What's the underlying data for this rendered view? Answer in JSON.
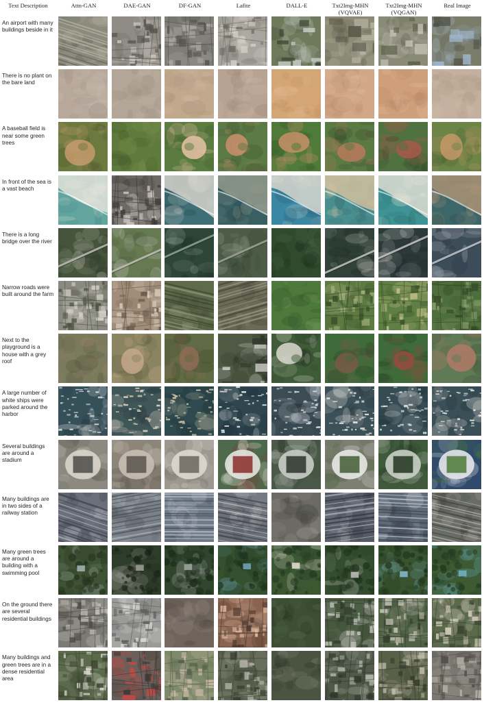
{
  "columns": [
    "Text Description",
    "Attn-GAN",
    "DAE-GAN",
    "DF-GAN",
    "Lafite",
    "DALL-E",
    "Txt2Img-MHN\n(VQVAE)",
    "Txt2Img-MHN\n(VQGAN)",
    "Real Image"
  ],
  "rows": [
    {
      "text": "An airport with many buildings beside in it",
      "tiles": [
        {
          "base": "#8c8b7e",
          "accent": "#b7b5a3",
          "dark": "#5f5e55",
          "pattern": "lines"
        },
        {
          "base": "#8f8c86",
          "accent": "#c9c4bd",
          "dark": "#5a5752",
          "pattern": "grid"
        },
        {
          "base": "#7f7d78",
          "accent": "#a9a6a0",
          "dark": "#55534f",
          "pattern": "grid"
        },
        {
          "base": "#a7a59d",
          "accent": "#d2d0c8",
          "dark": "#6c6a63",
          "pattern": "grid"
        },
        {
          "base": "#6f7a5c",
          "accent": "#c3c8c1",
          "dark": "#3d4634",
          "pattern": "blocks"
        },
        {
          "base": "#8b8a74",
          "accent": "#b9b7a5",
          "dark": "#57584a",
          "pattern": "blocks"
        },
        {
          "base": "#8a8a78",
          "accent": "#cfcfc2",
          "dark": "#5c5f4a",
          "pattern": "blocks"
        },
        {
          "base": "#7b7d6b",
          "accent": "#9fb6cc",
          "dark": "#4f5245",
          "pattern": "blocks"
        }
      ]
    },
    {
      "text": "There is no plant on the bare land",
      "tiles": [
        {
          "base": "#b7a89b",
          "accent": "#cdbfb3",
          "dark": "#9c8c80",
          "pattern": "soft"
        },
        {
          "base": "#b3a597",
          "accent": "#c8bbae",
          "dark": "#988a7d",
          "pattern": "soft"
        },
        {
          "base": "#c2a98e",
          "accent": "#d4bfa7",
          "dark": "#a78f75",
          "pattern": "soft"
        },
        {
          "base": "#b7a392",
          "accent": "#cdbbab",
          "dark": "#9a8776",
          "pattern": "soft"
        },
        {
          "base": "#d4a675",
          "accent": "#e4c199",
          "dark": "#b8885a",
          "pattern": "soft"
        },
        {
          "base": "#d1a787",
          "accent": "#e3c2a6",
          "dark": "#b48969",
          "pattern": "soft"
        },
        {
          "base": "#cf9f7c",
          "accent": "#e2bc9c",
          "dark": "#b3815f",
          "pattern": "soft"
        },
        {
          "base": "#c4b09e",
          "accent": "#d4c3b3",
          "dark": "#aa9683",
          "pattern": "soft"
        }
      ]
    },
    {
      "text": "A baseball field is near some green trees",
      "tiles": [
        {
          "base": "#6d7a3f",
          "accent": "#c59b6c",
          "dark": "#46502a",
          "pattern": "field"
        },
        {
          "base": "#5e7a3c",
          "accent": "#7b9350",
          "dark": "#3e5428",
          "pattern": "soft"
        },
        {
          "base": "#5b7c40",
          "accent": "#e9c3a7",
          "dark": "#3c5429",
          "pattern": "field"
        },
        {
          "base": "#5c7a45",
          "accent": "#c98f6d",
          "dark": "#39512c",
          "pattern": "field"
        },
        {
          "base": "#4f7a3a",
          "accent": "#c8916a",
          "dark": "#324f24",
          "pattern": "field"
        },
        {
          "base": "#5a7a44",
          "accent": "#b67a5c",
          "dark": "#2f4425",
          "pattern": "field"
        },
        {
          "base": "#507240",
          "accent": "#a8584a",
          "dark": "#2c4226",
          "pattern": "field"
        },
        {
          "base": "#6c8446",
          "accent": "#c59868",
          "dark": "#475c2e",
          "pattern": "field"
        }
      ]
    },
    {
      "text": "In front of the sea is a vast beach",
      "tiles": [
        {
          "base": "#62a59f",
          "accent": "#e9e6dd",
          "dark": "#3e7e7a",
          "pattern": "coast"
        },
        {
          "base": "#6d6965",
          "accent": "#c9c4bf",
          "dark": "#3b3835",
          "pattern": "grid"
        },
        {
          "base": "#3e6e76",
          "accent": "#dfd9cf",
          "dark": "#284b52",
          "pattern": "coast"
        },
        {
          "base": "#385f62",
          "accent": "#9a9d8f",
          "dark": "#223f43",
          "pattern": "coast"
        },
        {
          "base": "#3a87a3",
          "accent": "#e3ddd2",
          "dark": "#24566b",
          "pattern": "coast"
        },
        {
          "base": "#4a8f90",
          "accent": "#d9c3a0",
          "dark": "#2f6062",
          "pattern": "coast"
        },
        {
          "base": "#3f9394",
          "accent": "#e8e2d6",
          "dark": "#2a6566",
          "pattern": "coast"
        },
        {
          "base": "#3d6669",
          "accent": "#b09577",
          "dark": "#26474a",
          "pattern": "coast"
        }
      ]
    },
    {
      "text": "There is a long bridge over the river",
      "tiles": [
        {
          "base": "#45543b",
          "accent": "#b7b7ad",
          "dark": "#2c3727",
          "pattern": "bridge"
        },
        {
          "base": "#667a52",
          "accent": "#bbbcb0",
          "dark": "#435238",
          "pattern": "bridge"
        },
        {
          "base": "#2e4636",
          "accent": "#8c9c92",
          "dark": "#1b2c22",
          "pattern": "bridge"
        },
        {
          "base": "#4d5c46",
          "accent": "#98a090",
          "dark": "#2f3a2c",
          "pattern": "bridge"
        },
        {
          "base": "#2f4a2d",
          "accent": "#55704e",
          "dark": "#1c2d1b",
          "pattern": "soft"
        },
        {
          "base": "#30423a",
          "accent": "#bcbcb5",
          "dark": "#1d2a24",
          "pattern": "bridge"
        },
        {
          "base": "#2b3a38",
          "accent": "#c0c0bb",
          "dark": "#18232a",
          "pattern": "bridge"
        },
        {
          "base": "#3d4c59",
          "accent": "#b8bec5",
          "dark": "#27323d",
          "pattern": "bridge"
        }
      ]
    },
    {
      "text": "Narrow roads were built around the farm",
      "tiles": [
        {
          "base": "#8a8a82",
          "accent": "#d8d4cc",
          "dark": "#4d5240",
          "pattern": "grid"
        },
        {
          "base": "#a18d7a",
          "accent": "#d9cbbd",
          "dark": "#6a5a49",
          "pattern": "grid"
        },
        {
          "base": "#5f6a4a",
          "accent": "#93987c",
          "dark": "#3b4330",
          "pattern": "lines"
        },
        {
          "base": "#6b6a57",
          "accent": "#9d9a86",
          "dark": "#454536",
          "pattern": "lines"
        },
        {
          "base": "#4d7a3c",
          "accent": "#86a86a",
          "dark": "#2f4f25",
          "pattern": "soft"
        },
        {
          "base": "#5d7a42",
          "accent": "#a2b07c",
          "dark": "#384e28",
          "pattern": "grid"
        },
        {
          "base": "#5f7f44",
          "accent": "#c3c08a",
          "dark": "#3b532a",
          "pattern": "grid"
        },
        {
          "base": "#4f6e3d",
          "accent": "#89a06a",
          "dark": "#324826",
          "pattern": "grid"
        }
      ]
    },
    {
      "text": "Next to the playground is a house with a grey roof",
      "tiles": [
        {
          "base": "#7a7a5c",
          "accent": "#9b8470",
          "dark": "#4f4e3a",
          "pattern": "soft"
        },
        {
          "base": "#8a8560",
          "accent": "#c4a88c",
          "dark": "#5a5740",
          "pattern": "field"
        },
        {
          "base": "#606a44",
          "accent": "#8f6b55",
          "dark": "#3d4429",
          "pattern": "field"
        },
        {
          "base": "#4f5a45",
          "accent": "#d7d6d2",
          "dark": "#2f3629",
          "pattern": "blocks"
        },
        {
          "base": "#3f5c38",
          "accent": "#dad8d0",
          "dark": "#263923",
          "pattern": "field"
        },
        {
          "base": "#3f6a3a",
          "accent": "#7a5a48",
          "dark": "#284226",
          "pattern": "field"
        },
        {
          "base": "#3f6a3a",
          "accent": "#9a4a3e",
          "dark": "#284226",
          "pattern": "field"
        },
        {
          "base": "#5f7a55",
          "accent": "#b07a68",
          "dark": "#3b4c36",
          "pattern": "field"
        }
      ]
    },
    {
      "text": "A large number of white ships were parked around the harbor",
      "tiles": [
        {
          "base": "#355059",
          "accent": "#d9dbd9",
          "dark": "#1f3238",
          "pattern": "harbor"
        },
        {
          "base": "#40575a",
          "accent": "#d3cbb9",
          "dark": "#263638",
          "pattern": "harbor"
        },
        {
          "base": "#2f4a4f",
          "accent": "#c9c1a4",
          "dark": "#1b2e32",
          "pattern": "harbor"
        },
        {
          "base": "#2f4650",
          "accent": "#e2e1dc",
          "dark": "#1a2d35",
          "pattern": "harbor"
        },
        {
          "base": "#3b4c55",
          "accent": "#d2d6d8",
          "dark": "#222f36",
          "pattern": "harbor"
        },
        {
          "base": "#3c5058",
          "accent": "#dcdcd6",
          "dark": "#223239",
          "pattern": "harbor"
        },
        {
          "base": "#364c55",
          "accent": "#e0dfd9",
          "dark": "#1f2f36",
          "pattern": "harbor"
        },
        {
          "base": "#3a4f57",
          "accent": "#e4e3de",
          "dark": "#202f36",
          "pattern": "harbor"
        }
      ]
    },
    {
      "text": "Several buildings are around a stadium",
      "tiles": [
        {
          "base": "#8c8a80",
          "accent": "#d8d4cc",
          "dark": "#4e4c46",
          "pattern": "stadium"
        },
        {
          "base": "#8d857a",
          "accent": "#c6bfb2",
          "dark": "#5a554d",
          "pattern": "stadium"
        },
        {
          "base": "#9c9890",
          "accent": "#ddd8cf",
          "dark": "#6a665f",
          "pattern": "stadium"
        },
        {
          "base": "#4e6a4c",
          "accent": "#e6e4df",
          "dark": "#8a2e2a",
          "pattern": "stadium"
        },
        {
          "base": "#4b5a48",
          "accent": "#c9ccc8",
          "dark": "#2b3529",
          "pattern": "stadium"
        },
        {
          "base": "#7d7f72",
          "accent": "#e8e8e4",
          "dark": "#425c35",
          "pattern": "stadium"
        },
        {
          "base": "#3e5a3b",
          "accent": "#c9cfc6",
          "dark": "#223520",
          "pattern": "stadium"
        },
        {
          "base": "#2f4a6a",
          "accent": "#e4e6ea",
          "dark": "#4f7a3a",
          "pattern": "stadium"
        }
      ]
    },
    {
      "text": "Many buildings are in two sides of a railway station",
      "tiles": [
        {
          "base": "#6a6f7a",
          "accent": "#b8bbc4",
          "dark": "#3c404a",
          "pattern": "lines"
        },
        {
          "base": "#7a8088",
          "accent": "#b3b9bf",
          "dark": "#4b5057",
          "pattern": "lines"
        },
        {
          "base": "#6f7a88",
          "accent": "#b9c0c9",
          "dark": "#434b57",
          "pattern": "lines"
        },
        {
          "base": "#6c7078",
          "accent": "#c4c6ca",
          "dark": "#3e4148",
          "pattern": "lines"
        },
        {
          "base": "#6b6a64",
          "accent": "#a6a49c",
          "dark": "#403f3a",
          "pattern": "soft"
        },
        {
          "base": "#555b66",
          "accent": "#b2b6be",
          "dark": "#2e323a",
          "pattern": "lines"
        },
        {
          "base": "#5f6a78",
          "accent": "#c6ccd4",
          "dark": "#353d48",
          "pattern": "lines"
        },
        {
          "base": "#6a6c68",
          "accent": "#b9b7ae",
          "dark": "#3f413d",
          "pattern": "lines"
        }
      ]
    },
    {
      "text": "Many green trees are around a building with a swimming pool",
      "tiles": [
        {
          "base": "#3e5234",
          "accent": "#9fb2ad",
          "dark": "#263420",
          "pattern": "trees"
        },
        {
          "base": "#2e3d2a",
          "accent": "#9b9b93",
          "dark": "#1a2418",
          "pattern": "trees"
        },
        {
          "base": "#2f452c",
          "accent": "#9ba39a",
          "dark": "#1b2b1a",
          "pattern": "trees"
        },
        {
          "base": "#34502f",
          "accent": "#6fa2b5",
          "dark": "#1f331d",
          "pattern": "trees"
        },
        {
          "base": "#3b5833",
          "accent": "#e0d9cc",
          "dark": "#243921",
          "pattern": "trees"
        },
        {
          "base": "#344d2f",
          "accent": "#b7b9b2",
          "dark": "#1f321c",
          "pattern": "trees"
        },
        {
          "base": "#38532f",
          "accent": "#7fb6c8",
          "dark": "#22361d",
          "pattern": "trees"
        },
        {
          "base": "#3d5a33",
          "accent": "#6fb3c9",
          "dark": "#253b20",
          "pattern": "trees"
        }
      ]
    },
    {
      "text": "On the ground there are several residential buildings",
      "tiles": [
        {
          "base": "#7c7a74",
          "accent": "#c1bfb9",
          "dark": "#4c4a45",
          "pattern": "grid"
        },
        {
          "base": "#9a9a98",
          "accent": "#dcdcdb",
          "dark": "#5f5f5c",
          "pattern": "grid"
        },
        {
          "base": "#6e645c",
          "accent": "#958a80",
          "dark": "#4a413a",
          "pattern": "soft"
        },
        {
          "base": "#8a6450",
          "accent": "#d9b49a",
          "dark": "#4e3a30",
          "pattern": "grid"
        },
        {
          "base": "#3c4e34",
          "accent": "#5f7451",
          "dark": "#24301f",
          "pattern": "soft"
        },
        {
          "base": "#4c5e44",
          "accent": "#c5c5bf",
          "dark": "#2f3b2a",
          "pattern": "grid"
        },
        {
          "base": "#506246",
          "accent": "#c7c3b8",
          "dark": "#33402c",
          "pattern": "grid"
        },
        {
          "base": "#5c6a4c",
          "accent": "#d6cfbf",
          "dark": "#3a4530",
          "pattern": "grid"
        }
      ]
    },
    {
      "text": "Many buildings and green trees are in a dense residential area",
      "tiles": [
        {
          "base": "#5c6a4c",
          "accent": "#d9d6cf",
          "dark": "#3a4430",
          "pattern": "grid"
        },
        {
          "base": "#6a5f5a",
          "accent": "#c44a46",
          "dark": "#3e3734",
          "pattern": "grid"
        },
        {
          "base": "#7f8a6a",
          "accent": "#c9bba8",
          "dark": "#55604a",
          "pattern": "grid"
        },
        {
          "base": "#5c6450",
          "accent": "#b4b2a6",
          "dark": "#383e30",
          "pattern": "grid"
        },
        {
          "base": "#4a5440",
          "accent": "#8b8e7c",
          "dark": "#2d3427",
          "pattern": "soft"
        },
        {
          "base": "#4f5a48",
          "accent": "#b8b8b0",
          "dark": "#30382c",
          "pattern": "grid"
        },
        {
          "base": "#586048",
          "accent": "#c0bba9",
          "dark": "#363c2d",
          "pattern": "grid"
        },
        {
          "base": "#7a7870",
          "accent": "#b3afa5",
          "dark": "#4f4d47",
          "pattern": "grid"
        }
      ]
    }
  ]
}
